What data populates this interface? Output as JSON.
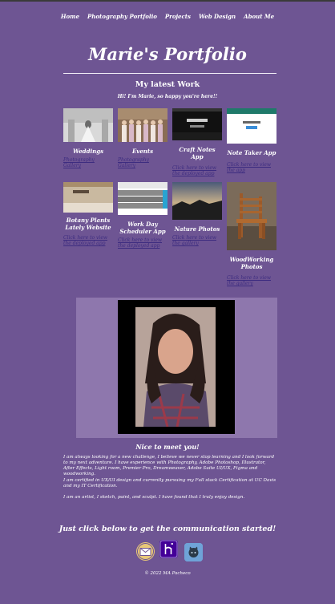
{
  "nav": {
    "items": [
      {
        "label": "Home"
      },
      {
        "label": "Photography Portfolio"
      },
      {
        "label": "Projects"
      },
      {
        "label": "Web Design"
      },
      {
        "label": "About Me"
      }
    ]
  },
  "header": {
    "title": "Marie's Portfolio"
  },
  "work": {
    "heading": "My latest Work",
    "intro": "Hi! I'm Marie, so happy you're here!!",
    "cards": [
      {
        "title": "Weddings",
        "link": "Photography Gallery"
      },
      {
        "title": "Events",
        "link": "Photography Gallery"
      },
      {
        "title": "Craft Notes App",
        "link": "Click here to view the deployed app"
      },
      {
        "title": "Note Taker App",
        "link": "Click here to view the app"
      },
      {
        "title": "Botany Plants Lately Website",
        "link": "Click here to view the deployed app"
      },
      {
        "title": "Work Day Scheduler App",
        "link": "Click here to view the deployed app"
      },
      {
        "title": "Nature Photos",
        "link": "Click here to view the gallery"
      },
      {
        "title": "WoodWorking Photos",
        "link": "Click here to view the gallery"
      }
    ]
  },
  "about": {
    "heading": "Nice to meet you!",
    "paragraphs": [
      "I am always looking for a new challenge, I believe we never stop learning and I look forward to my next adventure. I have experience with Photography, Adobe Photoshop, Illustrator, After Effects, Light room, Premier Pro, Dreamweaver, Adobe Suite UI/UX, Figma and woodworking.",
      "I am certified in UX/UI design and currently pursuing my Full stack Certification at UC Davis and my IT Certification.",
      "I am an artist, I sketch, paint, and sculpt. I have found that I truly enjoy design."
    ]
  },
  "contact": {
    "cta": "Just click below to get the communication started!",
    "icons": [
      "email-icon",
      "heroku-icon",
      "github-icon"
    ]
  },
  "footer": {
    "text": "© 2022 MA Pacheco"
  },
  "colors": {
    "background": "#6e5593",
    "link": "#3d2c80",
    "heroku": "#430098",
    "github": "#6fa3d8"
  }
}
